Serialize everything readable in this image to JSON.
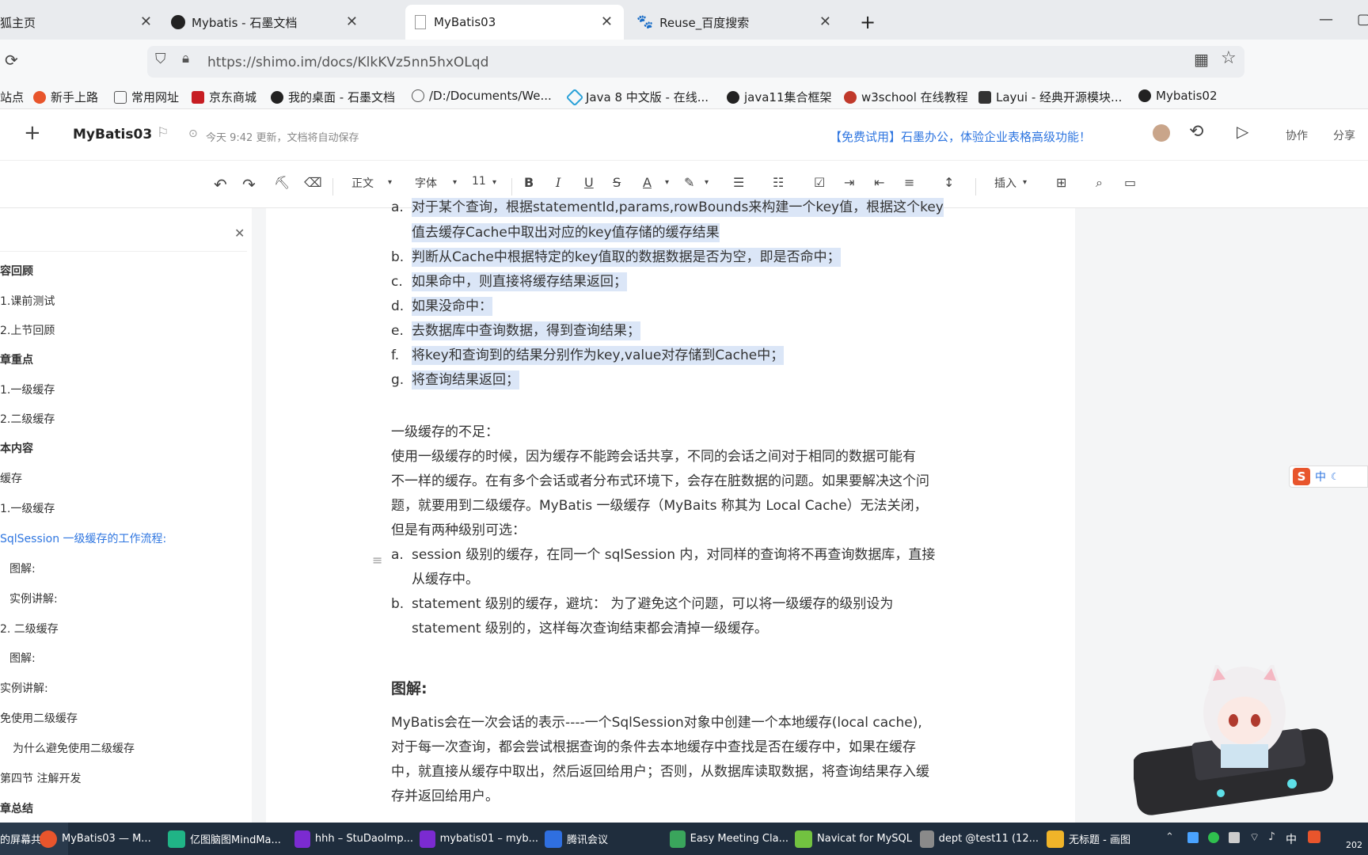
{
  "browser": {
    "tabs": [
      {
        "label": "狐主页",
        "active": false
      },
      {
        "label": "Mybatis - 石墨文档",
        "active": false
      },
      {
        "label": "MyBatis03",
        "active": true
      },
      {
        "label": "Reuse_百度搜索",
        "active": false
      }
    ],
    "new_tab": "+",
    "url": "https://shimo.im/docs/KlkKVz5nn5hxOLqd",
    "bookmarks": [
      "站点",
      "新手上路",
      "常用网址",
      "京东商城",
      "我的桌面 - 石墨文档",
      "/D:/Documents/We...",
      "Java 8 中文版 - 在线...",
      "java11集合框架",
      "w3school 在线教程",
      "Layui - 经典开源模块...",
      "Mybatis02"
    ]
  },
  "doc_header": {
    "add": "+",
    "title": "MyBatis03",
    "save_status": "今天 9:42 更新，文档将自动保存",
    "promo": "【免费试用】石墨办公，体验企业表格高级功能！",
    "collab": "协作",
    "share": "分享"
  },
  "toolbar": {
    "style": "正文",
    "font": "字体",
    "size": "11",
    "bold": "B",
    "italic": "I",
    "underline": "U",
    "strike": "S",
    "color": "A",
    "insert": "插入"
  },
  "sidebar": {
    "items": [
      "容回顾",
      "1.课前测试",
      "2.上节回顾",
      "章重点",
      "1.一级缓存",
      "2.二级缓存",
      "本内容",
      "缓存",
      "1.一级缓存",
      "SqlSession 一级缓存的工作流程:",
      "图解:",
      "实例讲解:",
      "2. 二级缓存",
      "图解:",
      "实例讲解:",
      "免使用二级缓存",
      "为什么避免使用二级缓存",
      "第四节  注解开发",
      "章总结"
    ]
  },
  "document": {
    "list1": [
      {
        "marker": "a.",
        "lines": [
          "对于某个查询，根据statementId,params,rowBounds来构建一个key值，根据这个key",
          "值去缓存Cache中取出对应的key值存储的缓存结果"
        ]
      },
      {
        "marker": "b.",
        "lines": [
          "判断从Cache中根据特定的key值取的数据数据是否为空，即是否命中；"
        ]
      },
      {
        "marker": "c.",
        "lines": [
          "如果命中，则直接将缓存结果返回；"
        ]
      },
      {
        "marker": "d.",
        "lines": [
          "如果没命中："
        ]
      },
      {
        "marker": "e.",
        "lines": [
          "去数据库中查询数据，得到查询结果；"
        ]
      },
      {
        "marker": "f.",
        "lines": [
          " 将key和查询到的结果分别作为key,value对存储到Cache中；"
        ]
      },
      {
        "marker": "g.",
        "lines": [
          "将查询结果返回；"
        ]
      }
    ],
    "para_title": "一级缓存的不足：",
    "para_lines": [
      "  使用一级缓存的时候，因为缓存不能跨会话共享，不同的会话之间对于相同的数据可能有",
      "不一样的缓存。在有多个会话或者分布式环境下，会存在脏数据的问题。如果要解决这个问",
      "题，就要用到二级缓存。MyBatis  一级缓存（MyBaits 称其为 Local Cache）无法关闭，",
      "但是有两种级别可选："
    ],
    "list2": [
      {
        "marker": "a.",
        "lines": [
          "session 级别的缓存，在同一个 sqlSession 内，对同样的查询将不再查询数据库，直接",
          "从缓存中。"
        ]
      },
      {
        "marker": "b.",
        "lines": [
          "statement 级别的缓存，避坑：  为了避免这个问题，可以将一级缓存的级别设为",
          "statement 级别的，这样每次查询结束都会清掉一级缓存。"
        ]
      }
    ],
    "heading": "图解:",
    "final_lines": [
      "MyBatis会在一次会话的表示----一个SqlSession对象中创建一个本地缓存(local   cache),",
      "对于每一次查询，都会尝试根据查询的条件去本地缓存中查找是否在缓存中，如果在缓存",
      "中，就直接从缓存中取出，然后返回给用户；否则，从数据库读取数据，将查询结果存入缓",
      "存并返回给用户。"
    ]
  },
  "ime": {
    "label": "中"
  },
  "taskbar": {
    "items": [
      "的屏幕共享",
      "MyBatis03 — M...",
      "亿图脑图MindMa...",
      "hhh – StuDaoImp...",
      "mybatis01 – myb...",
      "腾讯会议",
      "Easy Meeting Cla...",
      "Navicat for MySQL",
      "dept @test11 (12...",
      "无标题 - 画图"
    ],
    "tray_lang": "中",
    "clock": "202"
  },
  "colors": {
    "accent": "#2f76e0",
    "highlight": "#dbe6f7",
    "taskbar": "#1f2d3d"
  }
}
